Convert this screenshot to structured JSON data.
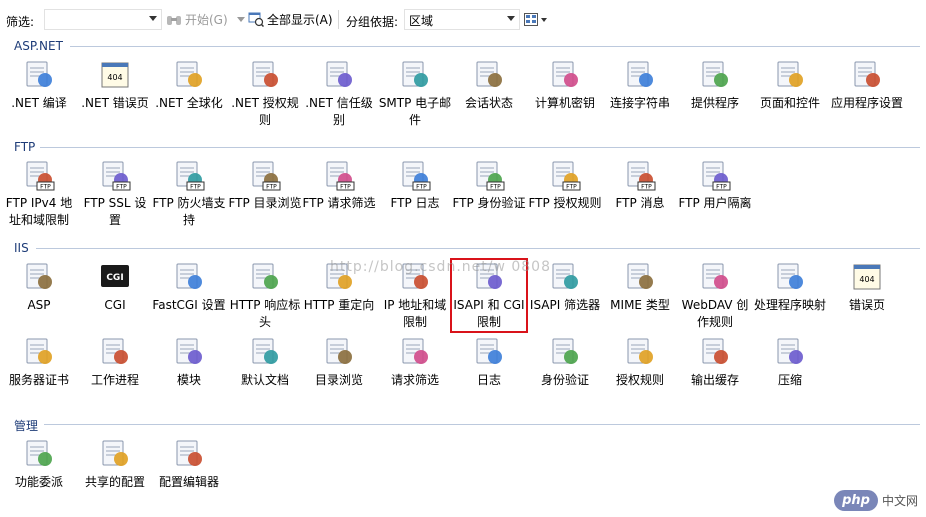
{
  "toolbar": {
    "filter_label": "筛选:",
    "start_label": "开始(G)",
    "show_all_label": "全部显示(A)",
    "group_by_label": "分组依据:",
    "group_by_value": "区域"
  },
  "groups": [
    {
      "title": "ASP.NET",
      "items": [
        {
          "label": ".NET 编译",
          "icon": "net-compile-icon"
        },
        {
          "label": ".NET 错误页",
          "icon": "net-error-page-icon"
        },
        {
          "label": ".NET 全球化",
          "icon": "globe-icon"
        },
        {
          "label": ".NET 授权规则",
          "icon": "auth-rules-icon"
        },
        {
          "label": ".NET 信任级别",
          "icon": "trust-level-icon"
        },
        {
          "label": "SMTP 电子邮件",
          "icon": "smtp-icon"
        },
        {
          "label": "会话状态",
          "icon": "session-state-icon"
        },
        {
          "label": "计算机密钥",
          "icon": "machine-key-icon"
        },
        {
          "label": "连接字符串",
          "icon": "connection-string-icon"
        },
        {
          "label": "提供程序",
          "icon": "providers-icon"
        },
        {
          "label": "页面和控件",
          "icon": "pages-controls-icon"
        },
        {
          "label": "应用程序设置",
          "icon": "app-settings-icon"
        }
      ]
    },
    {
      "title": "FTP",
      "items": [
        {
          "label": "FTP IPv4 地址和域限制",
          "icon": "ftp-ip-icon"
        },
        {
          "label": "FTP SSL 设置",
          "icon": "ftp-ssl-icon"
        },
        {
          "label": "FTP 防火墙支持",
          "icon": "ftp-firewall-icon"
        },
        {
          "label": "FTP 目录浏览",
          "icon": "ftp-dir-browse-icon"
        },
        {
          "label": "FTP 请求筛选",
          "icon": "ftp-request-filter-icon"
        },
        {
          "label": "FTP 日志",
          "icon": "ftp-log-icon"
        },
        {
          "label": "FTP 身份验证",
          "icon": "ftp-auth-icon"
        },
        {
          "label": "FTP 授权规则",
          "icon": "ftp-authz-icon"
        },
        {
          "label": "FTP 消息",
          "icon": "ftp-message-icon"
        },
        {
          "label": "FTP 用户隔离",
          "icon": "ftp-user-isolation-icon"
        }
      ]
    },
    {
      "title": "IIS",
      "items": [
        {
          "label": "ASP",
          "icon": "asp-icon"
        },
        {
          "label": "CGI",
          "icon": "cgi-icon"
        },
        {
          "label": "FastCGI 设置",
          "icon": "fastcgi-icon"
        },
        {
          "label": "HTTP 响应标头",
          "icon": "http-headers-icon"
        },
        {
          "label": "HTTP 重定向",
          "icon": "http-redirect-icon"
        },
        {
          "label": "IP 地址和域限制",
          "icon": "ip-restrict-icon"
        },
        {
          "label": "ISAPI 和 CGI 限制",
          "icon": "isapi-cgi-icon"
        },
        {
          "label": "ISAPI 筛选器",
          "icon": "isapi-filter-icon"
        },
        {
          "label": "MIME 类型",
          "icon": "mime-icon"
        },
        {
          "label": "WebDAV 创作规则",
          "icon": "webdav-icon"
        },
        {
          "label": "处理程序映射",
          "icon": "handler-mapping-icon"
        },
        {
          "label": "错误页",
          "icon": "error-page-icon"
        },
        {
          "label": "服务器证书",
          "icon": "certificate-icon"
        },
        {
          "label": "工作进程",
          "icon": "worker-process-icon"
        },
        {
          "label": "模块",
          "icon": "modules-icon"
        },
        {
          "label": "默认文档",
          "icon": "default-doc-icon"
        },
        {
          "label": "目录浏览",
          "icon": "dir-browse-icon"
        },
        {
          "label": "请求筛选",
          "icon": "request-filter-icon"
        },
        {
          "label": "日志",
          "icon": "logging-icon"
        },
        {
          "label": "身份验证",
          "icon": "authentication-icon"
        },
        {
          "label": "授权规则",
          "icon": "authorization-icon"
        },
        {
          "label": "输出缓存",
          "icon": "output-cache-icon"
        },
        {
          "label": "压缩",
          "icon": "compression-icon"
        }
      ]
    },
    {
      "title": "管理",
      "items": [
        {
          "label": "功能委派",
          "icon": "feature-delegation-icon"
        },
        {
          "label": "共享的配置",
          "icon": "shared-config-icon"
        },
        {
          "label": "配置编辑器",
          "icon": "config-editor-icon"
        }
      ]
    }
  ],
  "watermark": "http://blog.csdn.net/w 0808",
  "brand": {
    "logo": "php",
    "site": "中文网"
  }
}
